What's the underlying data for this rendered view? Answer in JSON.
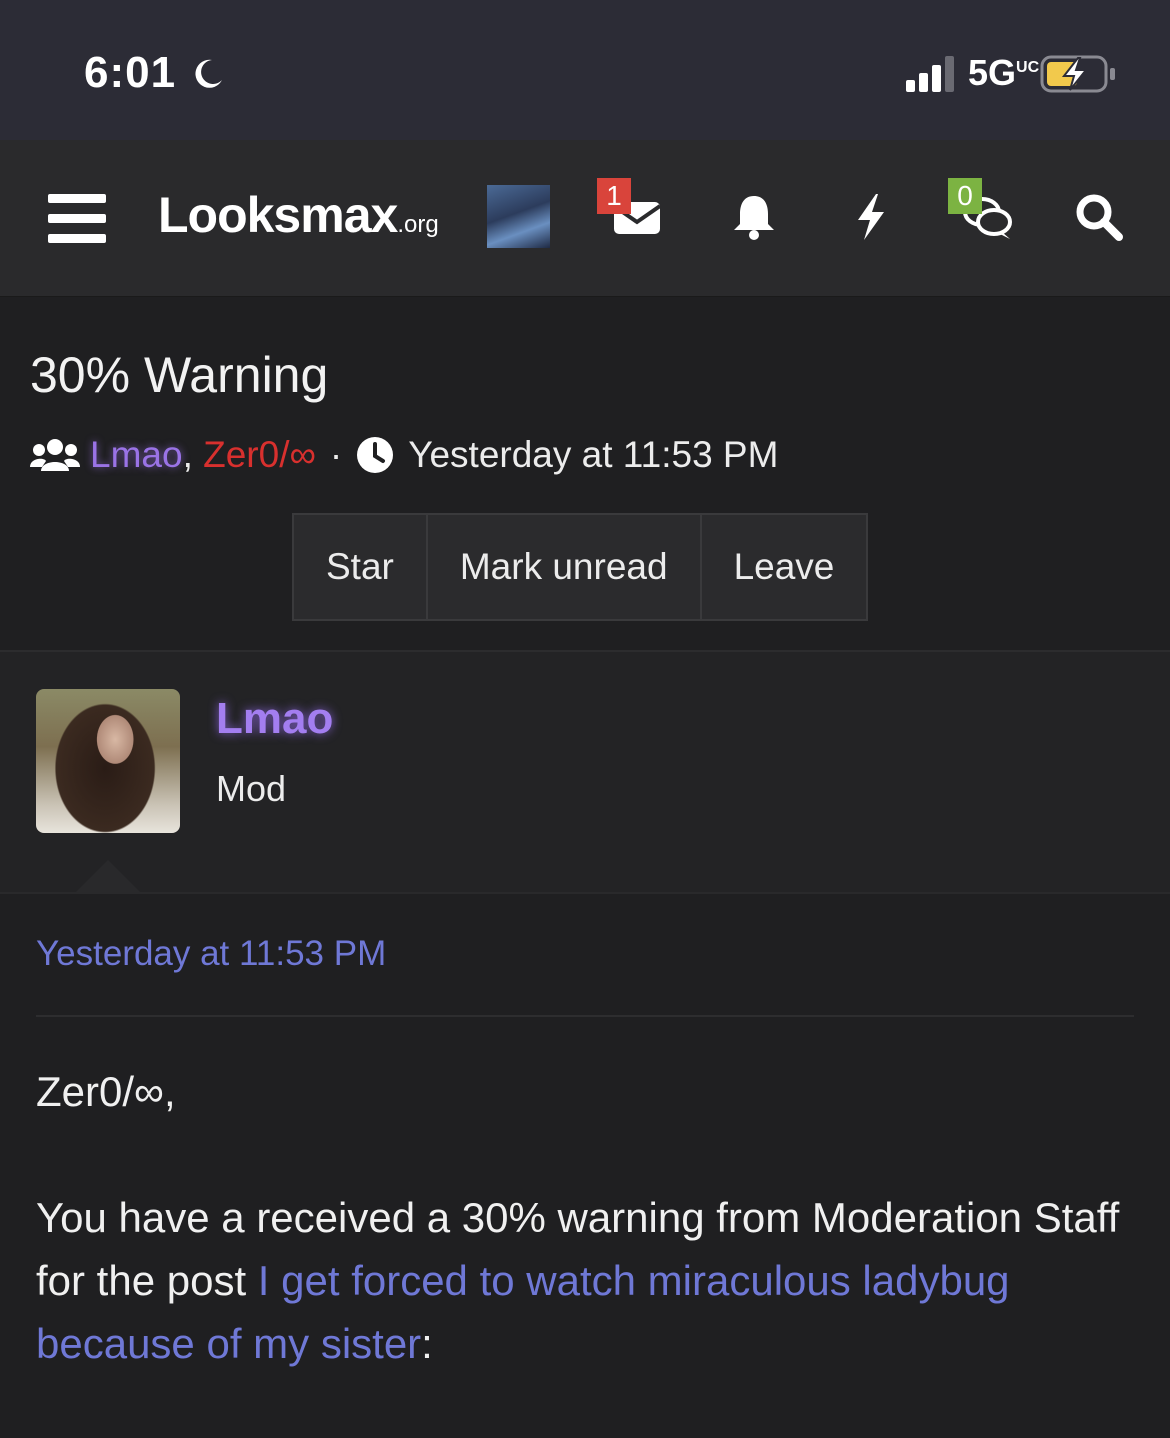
{
  "status_bar": {
    "time": "6:01",
    "network": "5G",
    "network_suffix": "UC"
  },
  "nav": {
    "logo_main": "Looksmax",
    "logo_suffix": ".org",
    "messages_badge": "1",
    "conversations_badge": "0",
    "badge_color_messages": "#d9443b",
    "badge_color_conversations": "#7cb342"
  },
  "conversation": {
    "title": "30% Warning",
    "participant_1": "Lmao",
    "participant_2": "Zer0/∞",
    "separator": "·",
    "timestamp": "Yesterday at 11:53 PM",
    "actions": {
      "star": "Star",
      "mark_unread": "Mark unread",
      "leave": "Leave"
    }
  },
  "message": {
    "username": "Lmao",
    "role": "Mod",
    "date": "Yesterday at 11:53 PM",
    "greeting": "Zer0/∞,",
    "body_prefix": "You have a received a 30% warning from Moderation Staff for the post ",
    "post_link": "I get forced to watch miraculous ladybug because of my sister",
    "body_suffix": ":"
  },
  "colors": {
    "accent_link": "#6f78d6",
    "user_purple": "#9a73e6",
    "user_red": "#d8302e"
  }
}
